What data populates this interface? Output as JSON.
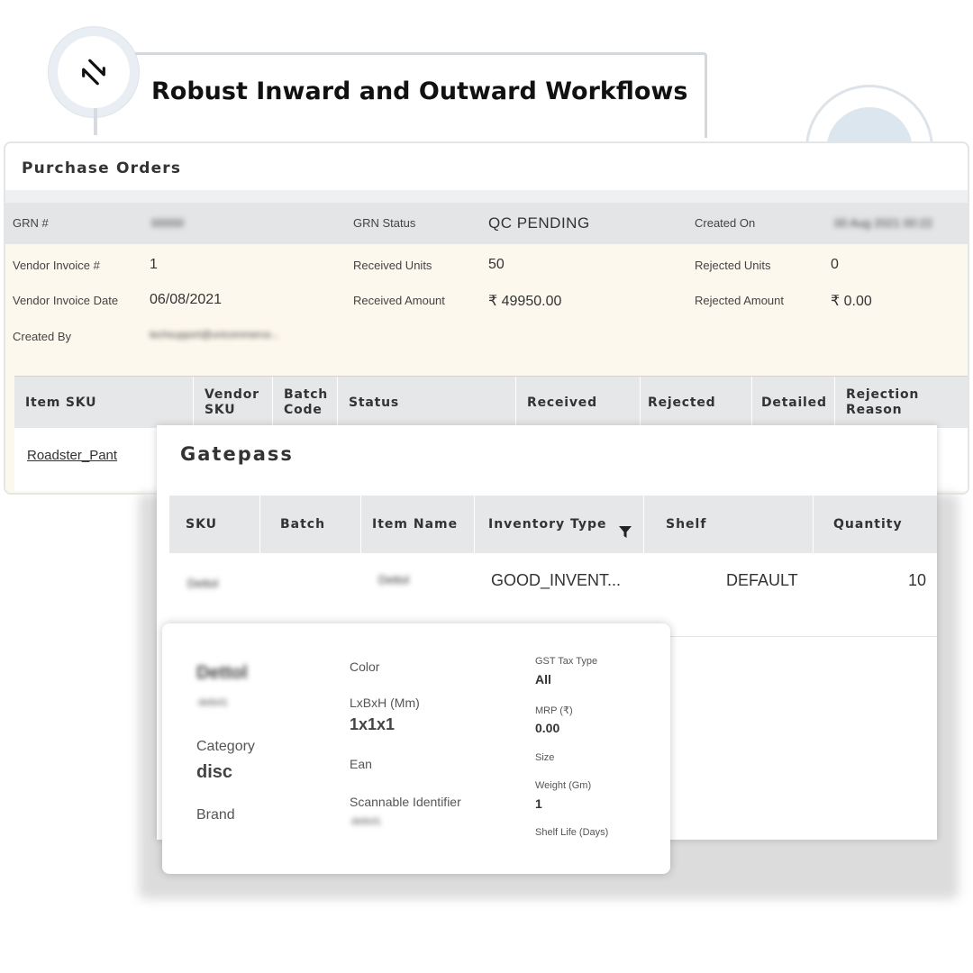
{
  "header": {
    "icon": "refresh-cycle-icon",
    "title": "Robust Inward and Outward Workflows"
  },
  "purchase_orders": {
    "title": "Purchase Orders",
    "grn": {
      "label": "GRN #",
      "value": "00000",
      "status_label": "GRN Status",
      "status_value": "QC  PENDING",
      "created_on_label": "Created On",
      "created_on_value": "00 Aug 2021 00:22"
    },
    "vendor_invoice_label": "Vendor Invoice #",
    "vendor_invoice_value": "1",
    "received_units_label": "Received Units",
    "received_units_value": "50",
    "rejected_units_label": "Rejected Units",
    "rejected_units_value": "0",
    "vendor_invoice_date_label": "Vendor Invoice Date",
    "vendor_invoice_date_value": "06/08/2021",
    "received_amount_label": "Received Amount",
    "received_amount_value": "₹ 49950.00",
    "rejected_amount_label": "Rejected Amount",
    "rejected_amount_value": "₹ 0.00",
    "created_by_label": "Created By",
    "created_by_value": "techsupport@unicommerce...",
    "table": {
      "columns": [
        "Item SKU",
        "Vendor SKU",
        "Batch Code",
        "Status",
        "Received",
        "Rejected",
        "Detailed",
        "Rejection Reason"
      ],
      "row_sku": "Roadster_Pant"
    }
  },
  "gatepass": {
    "title": "Gatepass",
    "columns": [
      "SKU",
      "Batch",
      "Item Name",
      "Inventory Type",
      "Shelf",
      "Quantity"
    ],
    "row": {
      "sku": "Dettol",
      "batch": "",
      "item_name": "Dettol",
      "inventory_type": "GOOD_INVENT...",
      "shelf": "DEFAULT",
      "quantity": "10"
    }
  },
  "item_card": {
    "name": "Dettol",
    "code": "dettol1",
    "category_label": "Category",
    "category_value": "disc",
    "brand_label": "Brand",
    "color_label": "Color",
    "dimensions_label": "LxBxH (Mm)",
    "dimensions_value": "1x1x1",
    "ean_label": "Ean",
    "scannable_label": "Scannable Identifier",
    "scannable_value": "dettol1",
    "gst_label": "GST Tax Type",
    "gst_value": "All",
    "mrp_label": "MRP (₹)",
    "mrp_value": "0.00",
    "size_label": "Size",
    "weight_label": "Weight (Gm)",
    "weight_value": "1",
    "shelf_life_label": "Shelf Life (Days)"
  },
  "colors": {
    "accent": "#e8853a",
    "header_gray": "#e3e5e6",
    "details_bg": "#fdf8ee"
  }
}
